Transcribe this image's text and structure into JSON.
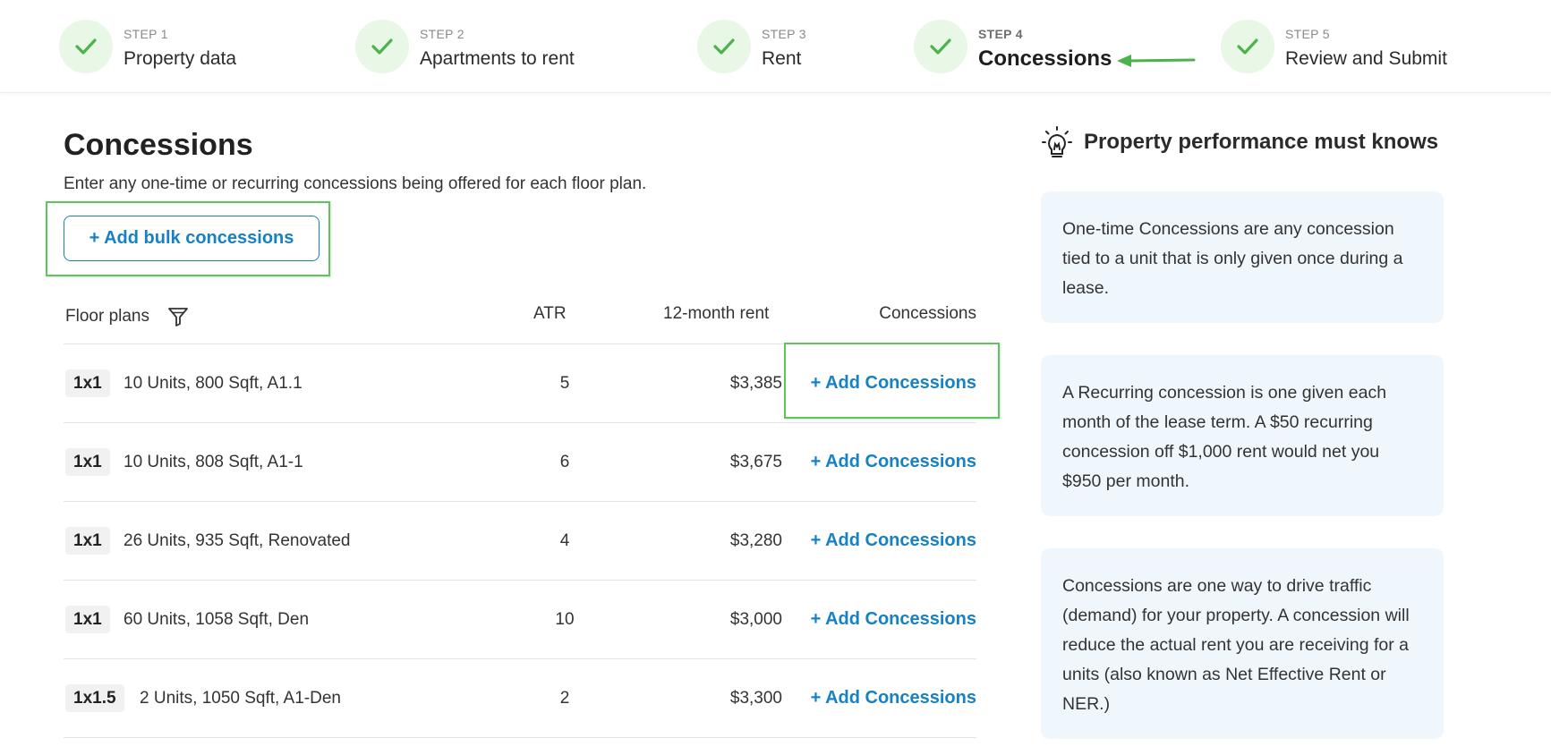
{
  "stepper": {
    "steps": [
      {
        "number": "STEP 1",
        "title": "Property data"
      },
      {
        "number": "STEP 2",
        "title": "Apartments to rent"
      },
      {
        "number": "STEP 3",
        "title": "Rent"
      },
      {
        "number": "STEP 4",
        "title": "Concessions",
        "active": true
      },
      {
        "number": "STEP 5",
        "title": "Review and Submit"
      }
    ],
    "check_icon": "check-icon",
    "completed_color": "#e8f7e6",
    "check_color": "#4cb34c"
  },
  "main": {
    "title": "Concessions",
    "subtitle": "Enter any one-time or recurring concessions being offered for each floor plan.",
    "bulk_button_label": "+ Add bulk concessions",
    "accent_color": "#1681c4",
    "highlight_color": "#5cc65c"
  },
  "table": {
    "headers": {
      "floor_plans": "Floor plans",
      "atr": "ATR",
      "rent": "12-month rent",
      "concessions": "Concessions"
    },
    "filter_icon": "filter-icon",
    "rows": [
      {
        "unit": "1x1",
        "description": "10 Units, 800 Sqft, A1.1",
        "atr": "5",
        "rent": "$3,385",
        "action": "+ Add Concessions"
      },
      {
        "unit": "1x1",
        "description": "10 Units, 808 Sqft, A1-1",
        "atr": "6",
        "rent": "$3,675",
        "action": "+ Add Concessions"
      },
      {
        "unit": "1x1",
        "description": "26 Units, 935 Sqft, Renovated",
        "atr": "4",
        "rent": "$3,280",
        "action": "+ Add Concessions"
      },
      {
        "unit": "1x1",
        "description": "60 Units, 1058 Sqft, Den",
        "atr": "10",
        "rent": "$3,000",
        "action": "+ Add Concessions"
      },
      {
        "unit": "1x1.5",
        "description": "2 Units, 1050 Sqft, A1-Den",
        "atr": "2",
        "rent": "$3,300",
        "action": "+ Add Concessions"
      }
    ]
  },
  "sidebar": {
    "icon": "lightbulb-icon",
    "title": "Property performance must knows",
    "tips": [
      "One-time Concessions are any concession tied to a unit that is only given once during a lease.",
      "A Recurring concession is one given each month of the lease term. A $50 recurring concession off $1,000 rent would net you $950 per month.",
      "Concessions are one way to drive traffic (demand) for your property. A concession will reduce the actual rent you are receiving for a units (also known as Net Effective Rent or NER.)"
    ],
    "card_color": "#eff7fd"
  }
}
